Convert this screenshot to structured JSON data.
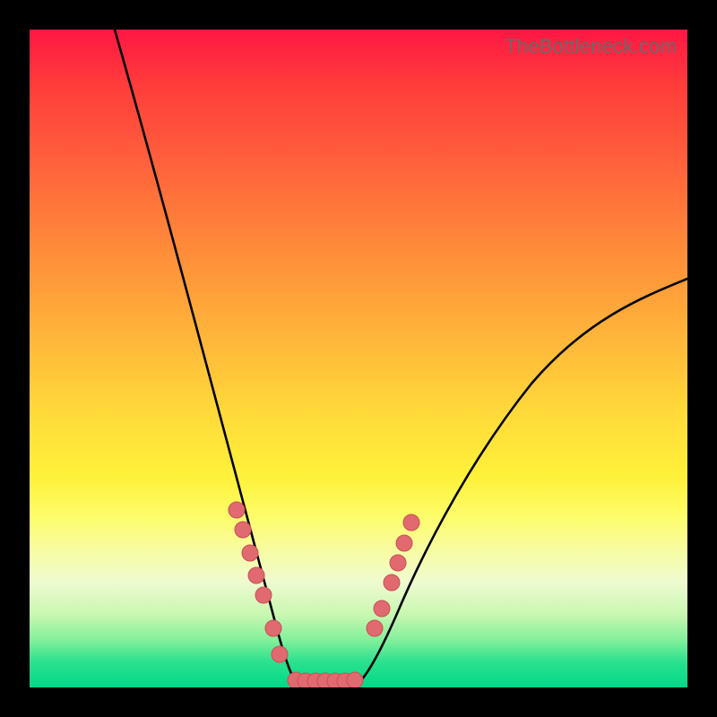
{
  "watermark": "TheBottleneck.com",
  "chart_data": {
    "type": "line",
    "title": "",
    "xlabel": "",
    "ylabel": "",
    "xlim": [
      0,
      100
    ],
    "ylim": [
      0,
      100
    ],
    "left_curve": {
      "x": [
        13,
        15,
        17,
        19,
        21,
        23,
        25,
        27,
        29,
        31,
        33,
        35,
        37,
        38,
        39,
        40
      ],
      "values": [
        100,
        93,
        84,
        75,
        67,
        59,
        52,
        45,
        38,
        32,
        26,
        19,
        12,
        7,
        3,
        1
      ]
    },
    "right_curve": {
      "x": [
        50,
        51,
        52,
        54,
        56,
        58,
        60,
        63,
        66,
        70,
        75,
        80,
        85,
        90,
        95,
        100
      ],
      "values": [
        1,
        3,
        6,
        10,
        14,
        18,
        22,
        26,
        30,
        35,
        40,
        45,
        50,
        55,
        60,
        62
      ]
    },
    "flat_band": {
      "x_start": 40,
      "x_end": 50,
      "y": 1
    },
    "markers_left": {
      "x": [
        31.5,
        32.5,
        33.5,
        34.5,
        35.5,
        37.0,
        38.0
      ],
      "values": [
        27,
        24,
        20.5,
        17,
        14,
        9,
        5
      ]
    },
    "markers_right": {
      "x": [
        52.5,
        53.5,
        55.0,
        56.0,
        57.0,
        58.0
      ],
      "values": [
        9,
        12,
        16,
        19,
        22,
        25
      ]
    },
    "flat_markers": {
      "x": [
        40.5,
        42,
        43.5,
        45,
        46.5,
        48,
        49.5
      ],
      "values": [
        1,
        1,
        1,
        1,
        1,
        1,
        1
      ]
    },
    "marker_color": "#e06a6f"
  }
}
